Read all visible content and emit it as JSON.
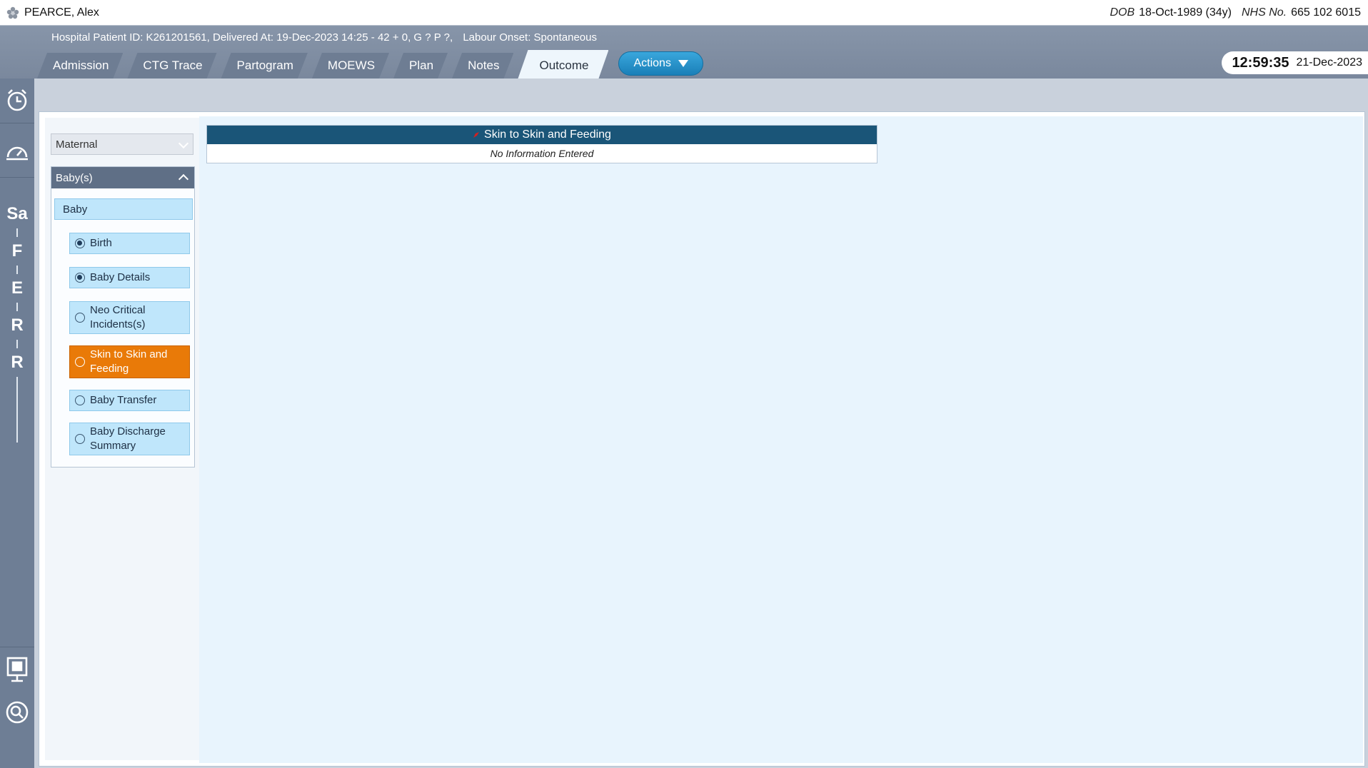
{
  "patient": {
    "name": "PEARCE, Alex",
    "dob_label": "DOB",
    "dob_value": "18-Oct-1989 (34y)",
    "nhs_label": "NHS No.",
    "nhs_value": "665 102 6015"
  },
  "header": {
    "hospital_id": "Hospital Patient ID: K261201561, Delivered At: 19-Dec-2023 14:25 - 42 + 0, G ? P ?,",
    "labour_onset": "Labour Onset: Spontaneous"
  },
  "tabs": [
    {
      "label": "Admission"
    },
    {
      "label": "CTG Trace"
    },
    {
      "label": "Partogram"
    },
    {
      "label": "MOEWS"
    },
    {
      "label": "Plan"
    },
    {
      "label": "Notes"
    },
    {
      "label": "Outcome"
    }
  ],
  "active_tab": "Outcome",
  "actions_label": "Actions",
  "clock": {
    "time": "12:59:35",
    "date": "21-Dec-2023"
  },
  "rail": {
    "letters": [
      "Sa",
      "F",
      "E",
      "R",
      "R"
    ],
    "icons": [
      "alarm-clock-icon",
      "timer-dial-icon",
      "presentation-board-icon",
      "search-icon"
    ]
  },
  "nav": {
    "maternal_label": "Maternal",
    "babies_label": "Baby(s)",
    "baby_label": "Baby",
    "items": [
      {
        "label": "Birth",
        "selected": true
      },
      {
        "label": "Baby Details",
        "selected": true
      },
      {
        "label": "Neo Critical Incidents(s)",
        "selected": false
      },
      {
        "label": "Skin to Skin and Feeding",
        "selected": false,
        "active": true
      },
      {
        "label": "Baby Transfer",
        "selected": false
      },
      {
        "label": "Baby Discharge Summary",
        "selected": false
      }
    ]
  },
  "section": {
    "title": "Skin to Skin and Feeding",
    "empty_text": "No Information Entered"
  },
  "colors": {
    "accent": "#1a5578",
    "active_item": "#e97a08",
    "item_bg": "#bfe6fb"
  }
}
